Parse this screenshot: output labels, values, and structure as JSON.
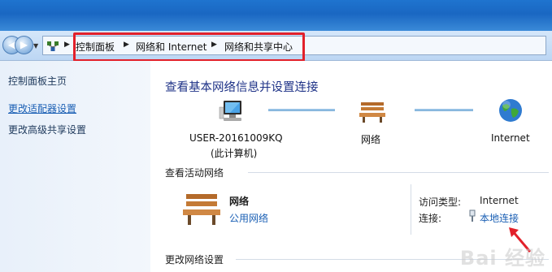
{
  "breadcrumb": {
    "items": [
      "控制面板",
      "网络和 Internet",
      "网络和共享中心"
    ]
  },
  "left_pane": {
    "home": "控制面板主页",
    "links": [
      "更改适配器设置",
      "更改高级共享设置"
    ]
  },
  "main": {
    "title": "查看基本网络信息并设置连接",
    "map": {
      "computer_name": "USER-20161009KQ",
      "computer_note": "(此计算机)",
      "network": "网络",
      "internet": "Internet"
    },
    "active_section": "查看活动网络",
    "active_network": {
      "name": "网络",
      "category": "公用网络",
      "access_type_label": "访问类型:",
      "access_type_value": "Internet",
      "connections_label": "连接:",
      "connections_value": "本地连接"
    },
    "change_section": "更改网络设置"
  },
  "watermark": "Bai 经验",
  "icons": [
    "back-arrow-icon",
    "forward-arrow-icon",
    "network-center-icon",
    "computer-icon",
    "bench-icon",
    "globe-icon",
    "network-adapter-icon",
    "red-pointer-arrow"
  ],
  "colors": {
    "highlight_box": "#e2202a",
    "link": "#1a5fb4",
    "title": "#1e3287"
  }
}
